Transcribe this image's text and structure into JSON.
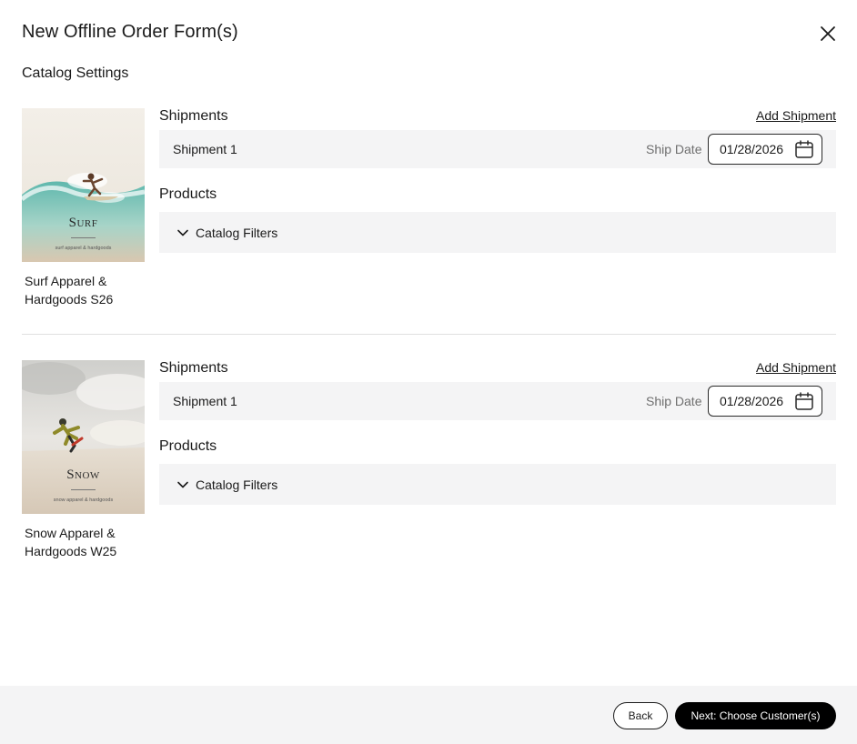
{
  "modal": {
    "title": "New Offline Order Form(s)",
    "section_label": "Catalog Settings"
  },
  "catalogs": [
    {
      "name": "Surf Apparel & Hardgoods S26",
      "cover_title": "Surf",
      "cover_subtitle": "surf apparel & hardgoods",
      "shipments_heading": "Shipments",
      "add_shipment_label": "Add Shipment",
      "shipment_name": "Shipment 1",
      "ship_date_label": "Ship Date",
      "ship_date_value": "01/28/2026",
      "products_heading": "Products",
      "filters_label": "Catalog Filters"
    },
    {
      "name": "Snow Apparel & Hardgoods W25",
      "cover_title": "Snow",
      "cover_subtitle": "snow apparel & hardgoods",
      "shipments_heading": "Shipments",
      "add_shipment_label": "Add Shipment",
      "shipment_name": "Shipment 1",
      "ship_date_label": "Ship Date",
      "ship_date_value": "01/28/2026",
      "products_heading": "Products",
      "filters_label": "Catalog Filters"
    }
  ],
  "footer": {
    "back_label": "Back",
    "next_label": "Next: Choose Customer(s)"
  },
  "icons": {
    "close": "close-icon",
    "calendar": "calendar-icon",
    "chevron": "chevron-down-icon"
  },
  "colors": {
    "primary_button": "#000000",
    "panel_background": "#f4f4f5",
    "muted_text": "#6f6f6f"
  }
}
